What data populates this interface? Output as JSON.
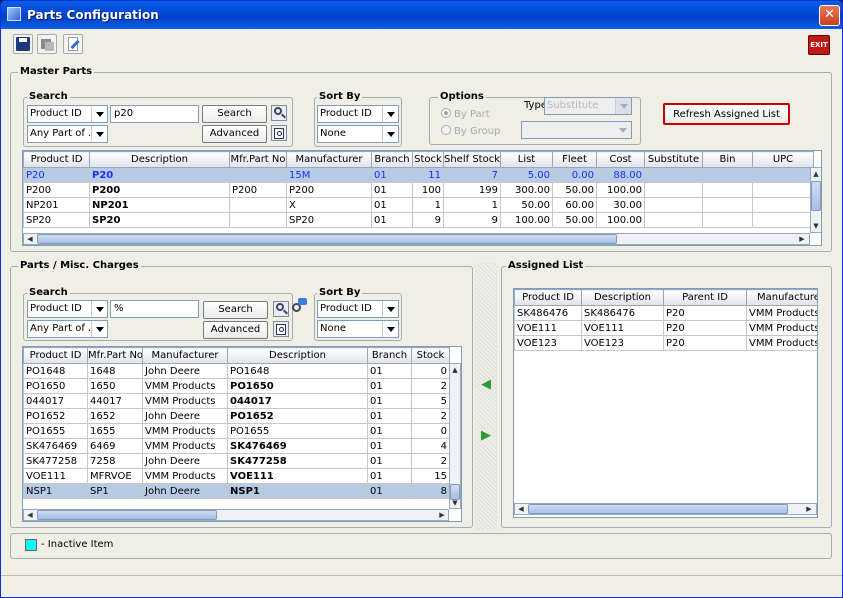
{
  "window": {
    "title": "Parts Configuration",
    "close": "✕"
  },
  "toolbar": {
    "exit_label": "EXIT"
  },
  "master": {
    "title": "Master Parts",
    "search_title": "Search",
    "search_field": "Product ID",
    "search_value": "p20",
    "match_mode": "Any Part of ...",
    "search_btn": "Search",
    "advanced_btn": "Advanced",
    "sort_title": "Sort By",
    "sort_field": "Product ID",
    "sort_second": "None",
    "options_title": "Options",
    "opt_by_part": "By Part",
    "opt_by_group": "By Group",
    "type_label": "Type",
    "type_value": "Substitute",
    "refresh_btn": "Refresh Assigned List",
    "columns": [
      "Product ID",
      "Description",
      "Mfr.Part No",
      "Manufacturer",
      "Branch",
      "Stock",
      "Shelf Stock",
      "List",
      "Fleet",
      "Cost",
      "Substitute",
      "Bin",
      "UPC"
    ],
    "rows": [
      [
        "P20",
        "P20",
        "",
        "15M",
        "01",
        "11",
        "7",
        "5.00",
        "0.00",
        "88.00",
        "",
        "",
        ""
      ],
      [
        "P200",
        "P200",
        "P200",
        "P200",
        "01",
        "100",
        "199",
        "300.00",
        "50.00",
        "100.00",
        "",
        "",
        ""
      ],
      [
        "NP201",
        "NP201",
        "",
        "X",
        "01",
        "1",
        "1",
        "50.00",
        "60.00",
        "30.00",
        "",
        "",
        ""
      ],
      [
        "SP20",
        "SP20",
        "",
        "SP20",
        "01",
        "9",
        "9",
        "100.00",
        "50.00",
        "100.00",
        "",
        "",
        ""
      ]
    ]
  },
  "parts": {
    "title": "Parts / Misc. Charges",
    "search_title": "Search",
    "search_field": "Product ID",
    "search_value": "%",
    "match_mode": "Any Part of ...",
    "search_btn": "Search",
    "advanced_btn": "Advanced",
    "sort_title": "Sort By",
    "sort_field": "Product ID",
    "sort_second": "None",
    "columns": [
      "Product ID",
      "Mfr.Part No",
      "Manufacturer",
      "Description",
      "Branch",
      "Stock"
    ],
    "rows": [
      [
        "PO1648",
        "1648",
        "John Deere",
        "PO1648",
        "01",
        "0"
      ],
      [
        "PO1650",
        "1650",
        "VMM Products",
        "PO1650",
        "01",
        "2"
      ],
      [
        "044017",
        "44017",
        "VMM Products",
        "044017",
        "01",
        "5"
      ],
      [
        "PO1652",
        "1652",
        "John Deere",
        "PO1652",
        "01",
        "2"
      ],
      [
        "PO1655",
        "1655",
        "VMM Products",
        "PO1655",
        "01",
        "0"
      ],
      [
        "SK476469",
        "6469",
        "VMM Products",
        "SK476469",
        "01",
        "4"
      ],
      [
        "SK477258",
        "7258",
        "John Deere",
        "SK477258",
        "01",
        "2"
      ],
      [
        "VOE111",
        "MFRVOE",
        "VMM Products",
        "VOE111",
        "01",
        "15"
      ],
      [
        "NSP1",
        "SP1",
        "John Deere",
        "NSP1",
        "01",
        "8"
      ]
    ]
  },
  "assigned": {
    "title": "Assigned List",
    "columns": [
      "Product ID",
      "Description",
      "Parent ID",
      "Manufacturer"
    ],
    "rows": [
      [
        "SK486476",
        "SK486476",
        "P20",
        "VMM Products"
      ],
      [
        "VOE111",
        "VOE111",
        "P20",
        "VMM Products"
      ],
      [
        "VOE123",
        "VOE123",
        "P20",
        "VMM Products"
      ]
    ]
  },
  "legend": {
    "text": "- Inactive Item",
    "color": "#00ffff"
  },
  "colors": {
    "titlebar": "#0a5ee8",
    "selection": "#b8cbe4",
    "highlight_text": "#1a2eff",
    "refresh_border": "#cc0000"
  }
}
